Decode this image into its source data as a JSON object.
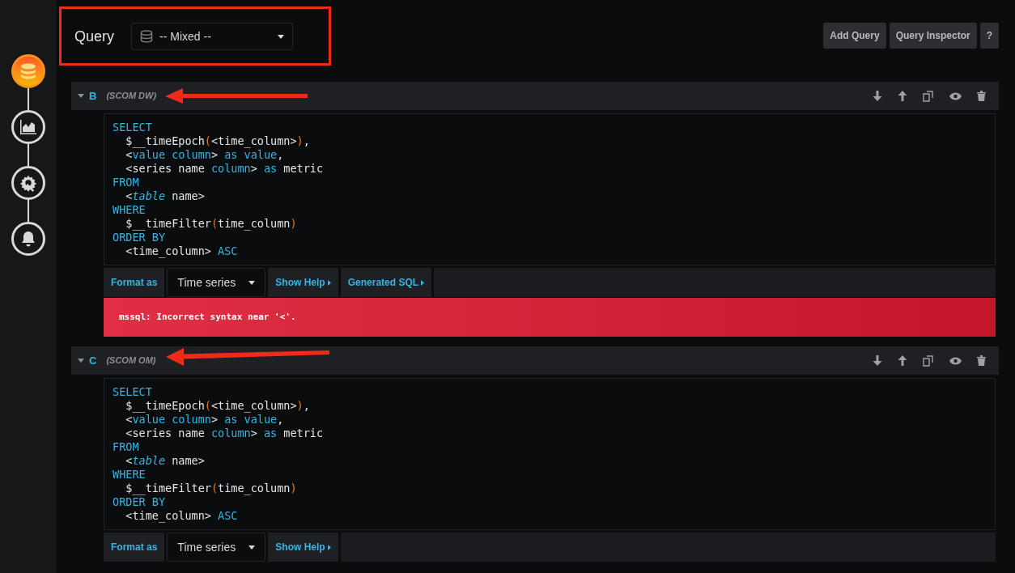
{
  "sidebar": [
    {
      "kind": "database",
      "selected": true
    },
    {
      "kind": "chart",
      "selected": false
    },
    {
      "kind": "settings",
      "selected": false
    },
    {
      "kind": "bell",
      "selected": false
    }
  ],
  "header": {
    "title": "Query",
    "datasource": "-- Mixed --"
  },
  "buttons": [
    "Add Query",
    "Query Inspector",
    "?"
  ],
  "queries": [
    {
      "ref": "B",
      "datasource": "(SCOM DW)",
      "expanded": true,
      "code": [
        [
          {
            "kind": "kw",
            "text": "SELECT"
          }
        ],
        [
          {
            "kind": "plain",
            "text": "  $__timeEpoch"
          },
          {
            "kind": "paren",
            "text": "("
          },
          {
            "kind": "plain",
            "text": "<time_column>"
          },
          {
            "kind": "paren",
            "text": ")"
          },
          {
            "kind": "plain",
            "text": ","
          }
        ],
        [
          {
            "kind": "plain",
            "text": "  <"
          },
          {
            "kind": "kw",
            "text": "value column"
          },
          {
            "kind": "plain",
            "text": "> "
          },
          {
            "kind": "kw",
            "text": "as value"
          },
          {
            "kind": "plain",
            "text": ","
          }
        ],
        [
          {
            "kind": "plain",
            "text": "  <series name "
          },
          {
            "kind": "kw",
            "text": "column"
          },
          {
            "kind": "plain",
            "text": "> "
          },
          {
            "kind": "kw",
            "text": "as"
          },
          {
            "kind": "plain",
            "text": " metric"
          }
        ],
        [
          {
            "kind": "kw",
            "text": "FROM"
          }
        ],
        [
          {
            "kind": "plain",
            "text": "  <"
          },
          {
            "kind": "kw_italic",
            "text": "table"
          },
          {
            "kind": "plain",
            "text": " name>"
          }
        ],
        [
          {
            "kind": "kw",
            "text": "WHERE"
          }
        ],
        [
          {
            "kind": "plain",
            "text": "  $__timeFilter"
          },
          {
            "kind": "paren",
            "text": "("
          },
          {
            "kind": "plain",
            "text": "time_column"
          },
          {
            "kind": "paren",
            "text": ")"
          }
        ],
        [
          {
            "kind": "kw",
            "text": "ORDER BY"
          }
        ],
        [
          {
            "kind": "plain",
            "text": "  <time_column> "
          },
          {
            "kind": "kw",
            "text": "ASC"
          }
        ]
      ],
      "format_label": "Format as",
      "format": "Time series",
      "links": [
        "Show Help",
        "Generated SQL"
      ],
      "error": "mssql: Incorrect syntax near '<'."
    },
    {
      "ref": "C",
      "datasource": "(SCOM OM)",
      "expanded": true,
      "code": [
        [
          {
            "kind": "kw",
            "text": "SELECT"
          }
        ],
        [
          {
            "kind": "plain",
            "text": "  $__timeEpoch"
          },
          {
            "kind": "paren",
            "text": "("
          },
          {
            "kind": "plain",
            "text": "<time_column>"
          },
          {
            "kind": "paren",
            "text": ")"
          },
          {
            "kind": "plain",
            "text": ","
          }
        ],
        [
          {
            "kind": "plain",
            "text": "  <"
          },
          {
            "kind": "kw",
            "text": "value column"
          },
          {
            "kind": "plain",
            "text": "> "
          },
          {
            "kind": "kw",
            "text": "as value"
          },
          {
            "kind": "plain",
            "text": ","
          }
        ],
        [
          {
            "kind": "plain",
            "text": "  <series name "
          },
          {
            "kind": "kw",
            "text": "column"
          },
          {
            "kind": "plain",
            "text": "> "
          },
          {
            "kind": "kw",
            "text": "as"
          },
          {
            "kind": "plain",
            "text": " metric"
          }
        ],
        [
          {
            "kind": "kw",
            "text": "FROM"
          }
        ],
        [
          {
            "kind": "plain",
            "text": "  <"
          },
          {
            "kind": "kw_italic",
            "text": "table"
          },
          {
            "kind": "plain",
            "text": " name>"
          }
        ],
        [
          {
            "kind": "kw",
            "text": "WHERE"
          }
        ],
        [
          {
            "kind": "plain",
            "text": "  $__timeFilter"
          },
          {
            "kind": "paren",
            "text": "("
          },
          {
            "kind": "plain",
            "text": "time_column"
          },
          {
            "kind": "paren",
            "text": ")"
          }
        ],
        [
          {
            "kind": "kw",
            "text": "ORDER BY"
          }
        ],
        [
          {
            "kind": "plain",
            "text": "  <time_column> "
          },
          {
            "kind": "kw",
            "text": "ASC"
          }
        ]
      ],
      "format_label": "Format as",
      "format": "Time series",
      "links": [
        "Show Help"
      ]
    }
  ]
}
